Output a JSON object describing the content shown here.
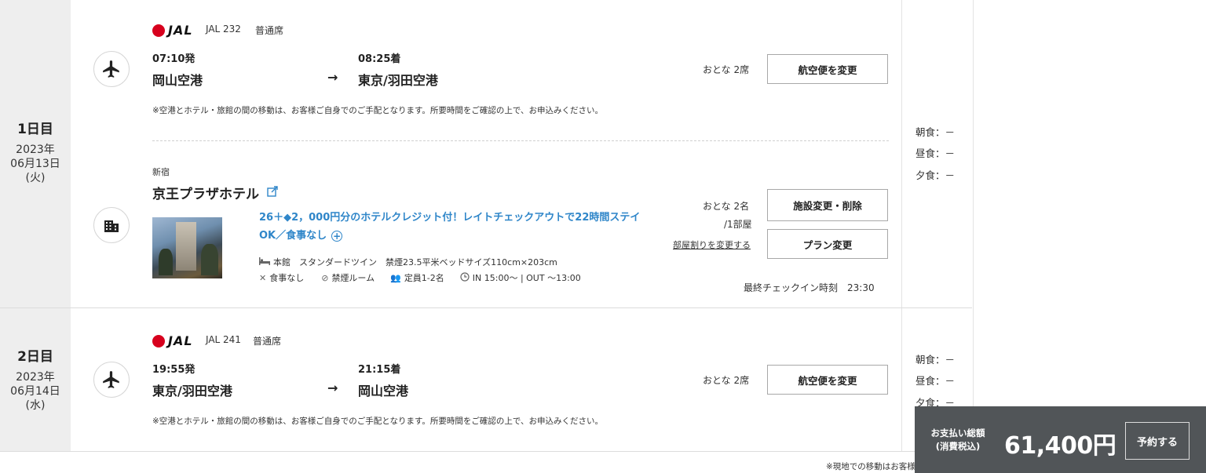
{
  "days": [
    {
      "label": "1日目",
      "date_year": "2023年",
      "date_md": "06月13日",
      "date_dow": "(火)",
      "meals": {
        "breakfast": "朝食：－",
        "lunch": "昼食：－",
        "dinner": "夕食：－"
      }
    },
    {
      "label": "2日目",
      "date_year": "2023年",
      "date_md": "06月14日",
      "date_dow": "(水)",
      "meals": {
        "breakfast": "朝食：－",
        "lunch": "昼食：－",
        "dinner": "夕食：－"
      }
    }
  ],
  "flights": [
    {
      "airline_logo": "JAL",
      "flight_no": "JAL 232",
      "seat_class": "普通席",
      "dep_time": "07:10発",
      "dep_airport": "岡山空港",
      "arrow": "→",
      "arr_time": "08:25着",
      "arr_airport": "東京/羽田空港",
      "passengers": "おとな 2席",
      "change_button": "航空便を変更",
      "note": "※空港とホテル・旅館の間の移動は、お客様ご自身でのご手配となります。所要時間をご確認の上で、お申込みください。"
    },
    {
      "airline_logo": "JAL",
      "flight_no": "JAL 241",
      "seat_class": "普通席",
      "dep_time": "19:55発",
      "dep_airport": "東京/羽田空港",
      "arrow": "→",
      "arr_time": "21:15着",
      "arr_airport": "岡山空港",
      "passengers": "おとな 2席",
      "change_button": "航空便を変更",
      "note": "※空港とホテル・旅館の間の移動は、お客様ご自身でのご手配となります。所要時間をご確認の上で、お申込みください。"
    }
  ],
  "hotel": {
    "area": "新宿",
    "name": "京王プラザホテル",
    "plan_line1": "26＋◆2，000円分のホテルクレジット付！レイトチェックアウトで22時間ステイ",
    "plan_line2": "OK／食事なし",
    "room_info": "本館　スタンダードツイン　禁煙23.5平米ベッドサイズ110cm×203cm",
    "meal_info": "食事なし",
    "smoking_info": "禁煙ルーム",
    "capacity_info": "定員1-2名",
    "checkin_out": "IN 15:00〜 | OUT 〜13:00",
    "guests": "おとな 2名",
    "rooms": "/1部屋",
    "change_room_split": "部屋割りを変更する",
    "change_delete_button": "施設変更・削除",
    "plan_change_button": "プラン変更",
    "last_checkin": "最終チェックイン時刻　23:30"
  },
  "payment": {
    "label_line1": "お支払い総額",
    "label_line2": "(消費税込)",
    "amount": "61,400円",
    "reserve_button": "予約する"
  },
  "footer_note": "※現地での移動はお客様負担です。",
  "colors": {
    "jal_red": "#d7001d",
    "link_blue": "#2f86c9",
    "paybar": "#515558",
    "day_bg": "#eeeeee"
  }
}
